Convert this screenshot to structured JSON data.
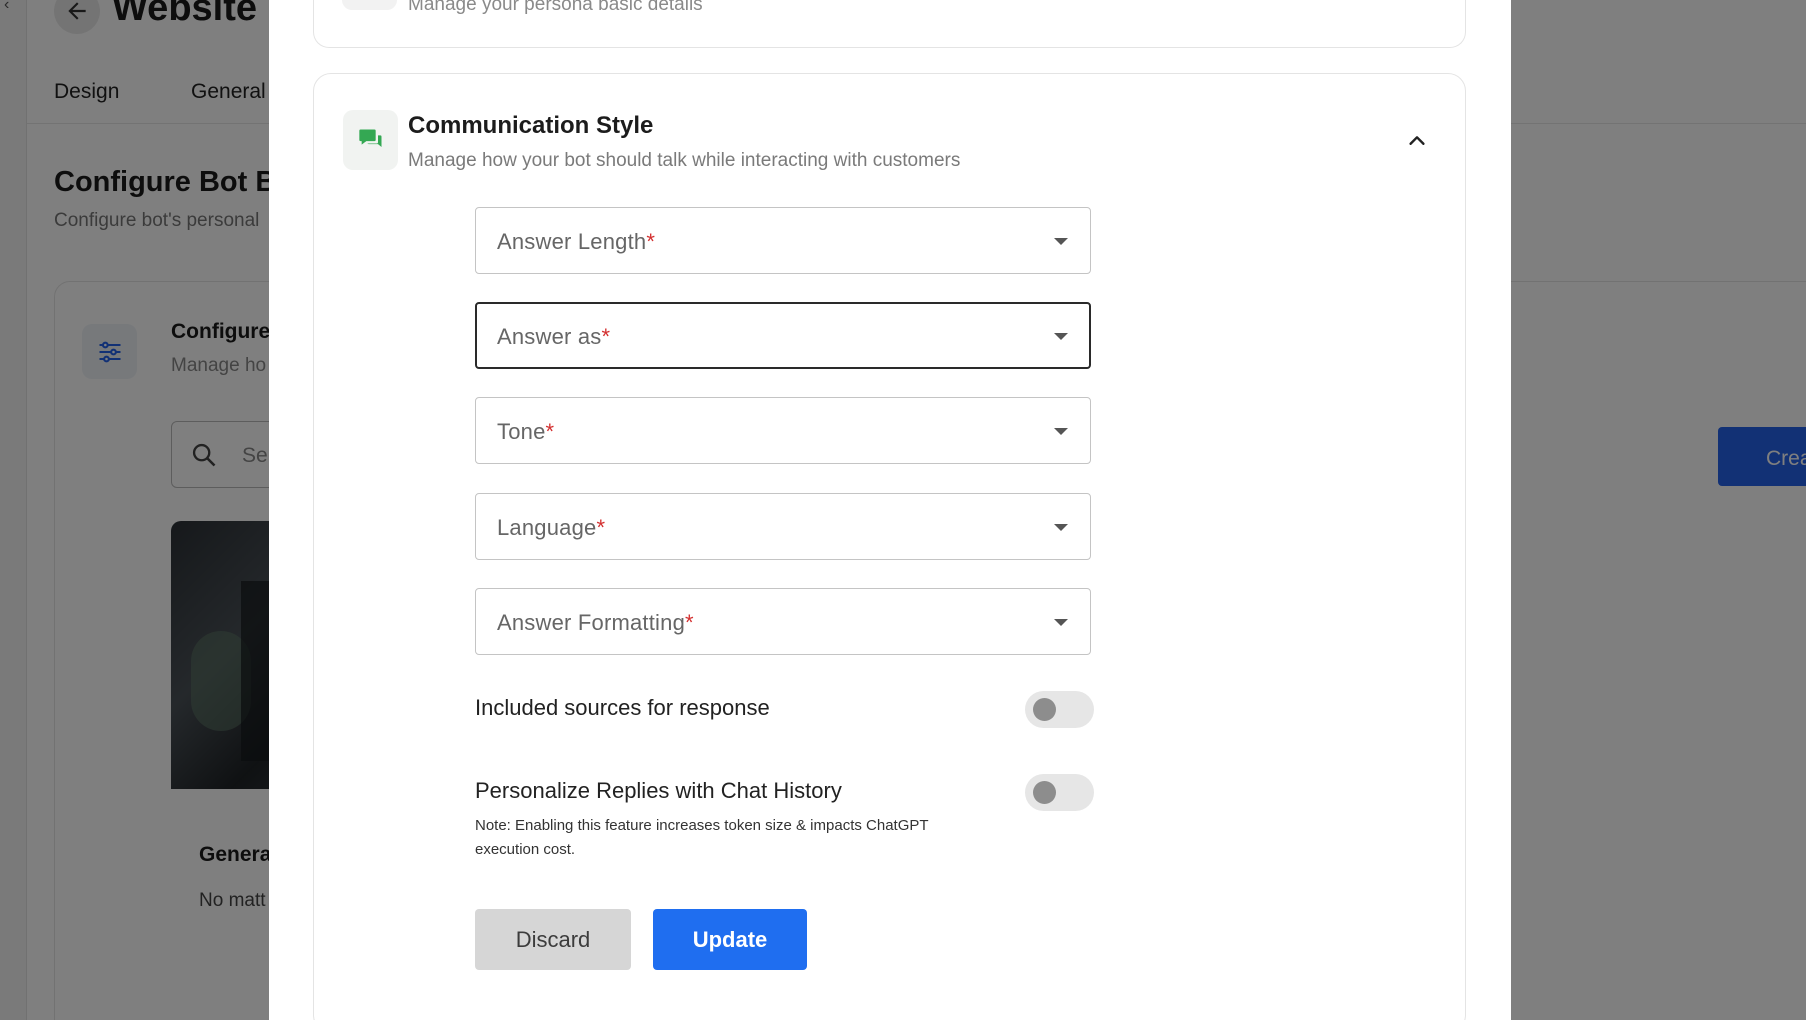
{
  "background": {
    "page_title": "Website",
    "tabs": [
      "Design",
      "General"
    ],
    "heading": "Configure Bot B",
    "subheading": "Configure bot's personal",
    "config_card": {
      "title": "Configure",
      "subtitle": "Manage ho"
    },
    "search_placeholder": "Se",
    "general_card": {
      "title": "Genera",
      "text": "No matt"
    },
    "create_button": "Crea"
  },
  "modal": {
    "persona_card": {
      "subtitle": "Manage your persona basic details"
    },
    "section": {
      "title": "Communication Style",
      "subtitle": "Manage how your bot should talk while interacting with customers",
      "icon": "chat-bubbles-icon",
      "icon_color": "#34a853"
    },
    "fields": [
      {
        "label": "Answer Length",
        "required": "*",
        "focused": false
      },
      {
        "label": "Answer as",
        "required": "*",
        "focused": true
      },
      {
        "label": "Tone",
        "required": "*",
        "focused": false
      },
      {
        "label": "Language",
        "required": "*",
        "focused": false
      },
      {
        "label": "Answer Formatting",
        "required": "*",
        "focused": false
      }
    ],
    "toggles": [
      {
        "label": "Included sources for response",
        "on": false
      },
      {
        "label": "Personalize Replies with Chat History",
        "on": false
      }
    ],
    "note": "Note: Enabling this feature increases token size & impacts ChatGPT execution cost.",
    "buttons": {
      "discard": "Discard",
      "update": "Update"
    },
    "colors": {
      "primary": "#1f6ef0",
      "required": "#d32f2f"
    }
  }
}
